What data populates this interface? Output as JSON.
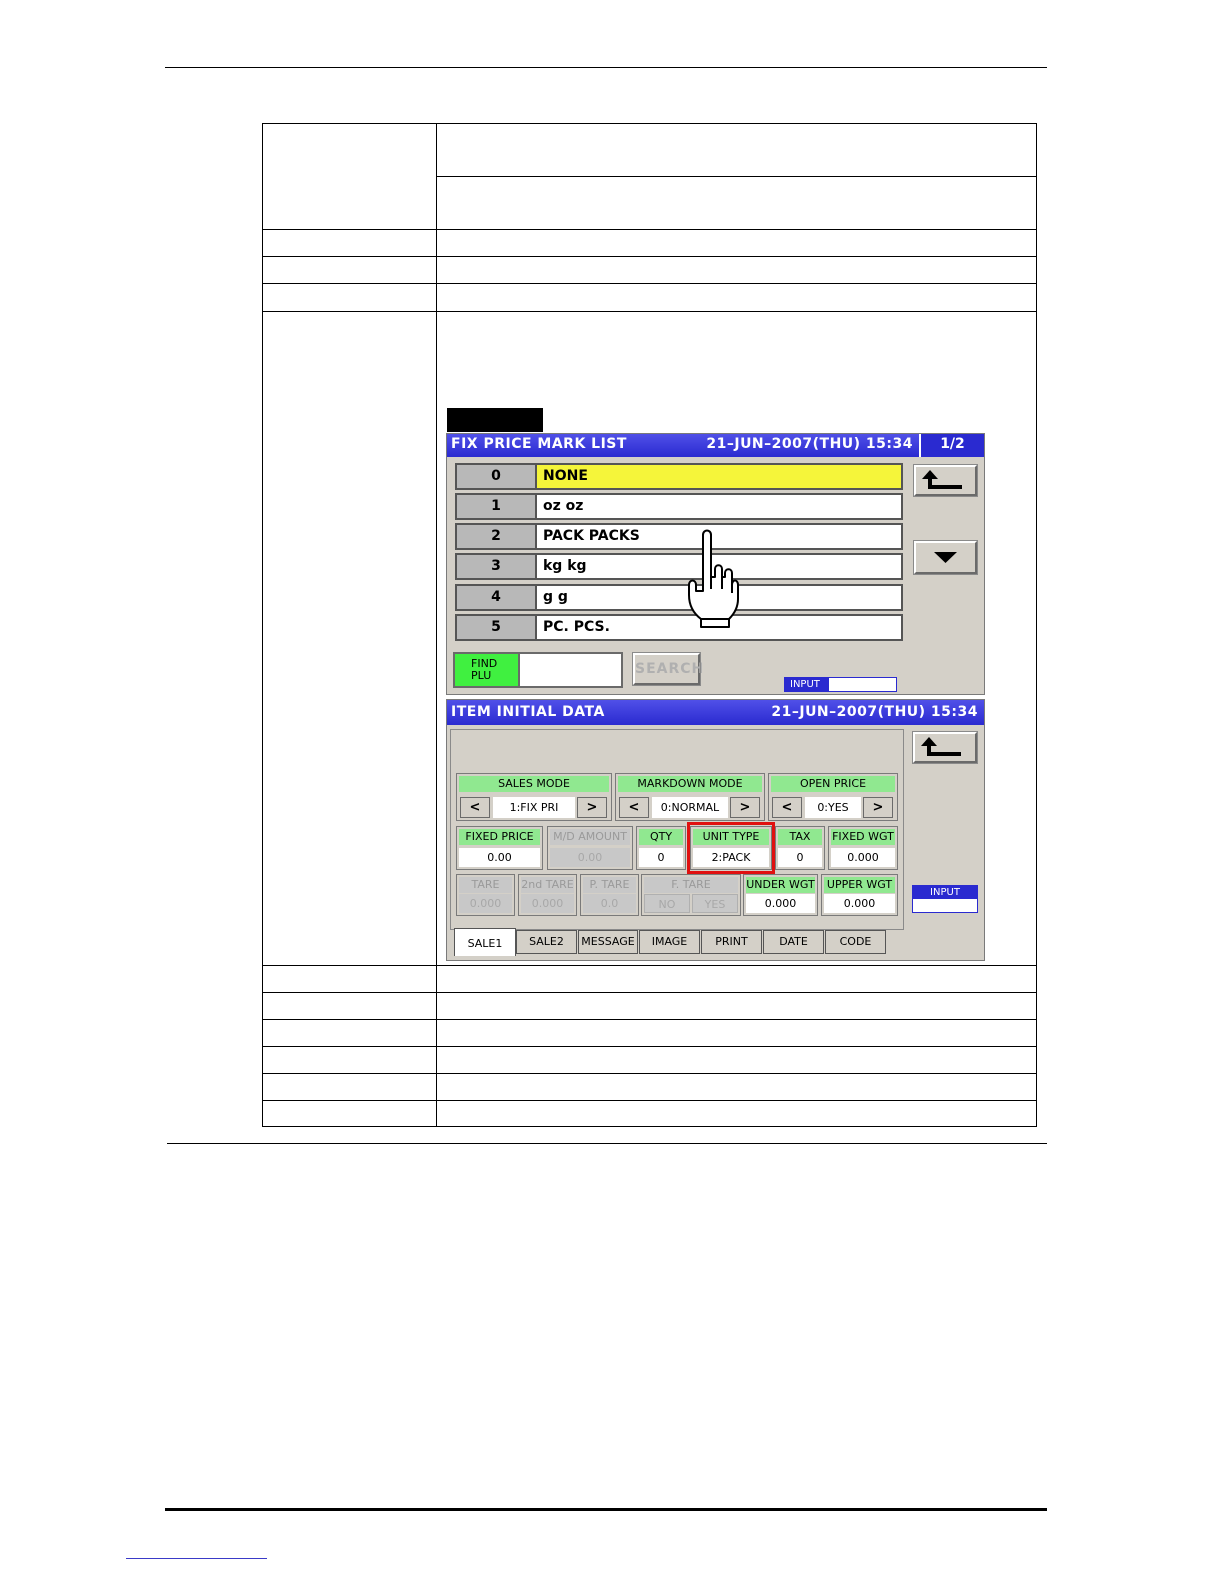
{
  "fix_price_mark_list": {
    "title": "FIX PRICE MARK LIST",
    "datetime": "21–JUN–2007(THU)  15:34",
    "page": "1/2",
    "items": [
      {
        "num": "0",
        "name": "NONE",
        "selected": true
      },
      {
        "num": "1",
        "name": "oz oz",
        "selected": false
      },
      {
        "num": "2",
        "name": "PACK PACKS",
        "selected": false
      },
      {
        "num": "3",
        "name": "kg kg",
        "selected": false
      },
      {
        "num": "4",
        "name": "g g",
        "selected": false
      },
      {
        "num": "5",
        "name": "PC. PCS.",
        "selected": false
      }
    ],
    "find_plu_label": "FIND\nPLU",
    "find_plu_line1": "FIND",
    "find_plu_line2": "PLU",
    "search_label": "SEARCH",
    "input_label": "INPUT"
  },
  "item_initial_data": {
    "title": "ITEM INITIAL DATA",
    "datetime": "21–JUN–2007(THU)  15:34",
    "sales_mode": {
      "label": "SALES MODE",
      "value": "1:FIX PRI"
    },
    "markdown_mode": {
      "label": "MARKDOWN MODE",
      "value": "0:NORMAL"
    },
    "open_price": {
      "label": "OPEN PRICE",
      "value": "0:YES"
    },
    "fixed_price": {
      "label": "FIXED PRICE",
      "value": "0.00"
    },
    "md_amount": {
      "label": "M/D AMOUNT",
      "value": "0.00"
    },
    "qty": {
      "label": "QTY",
      "value": "0"
    },
    "unit_type": {
      "label": "UNIT TYPE",
      "value": "2:PACK"
    },
    "tax": {
      "label": "TAX",
      "value": "0"
    },
    "fixed_wgt": {
      "label": "FIXED WGT",
      "value": "0.000"
    },
    "tare": {
      "label": "TARE",
      "value": "0.000"
    },
    "tare2": {
      "label": "2nd TARE",
      "value": "0.000"
    },
    "p_tare": {
      "label": "P. TARE",
      "value": "0.0"
    },
    "f_tare": {
      "label": "F. TARE",
      "no": "NO",
      "yes": "YES"
    },
    "under_wgt": {
      "label": "UNDER WGT",
      "value": "0.000"
    },
    "upper_wgt": {
      "label": "UPPER WGT",
      "value": "0.000"
    },
    "input_label": "INPUT",
    "tabs": [
      "SALE1",
      "SALE2",
      "MESSAGE",
      "IMAGE",
      "PRINT",
      "DATE",
      "CODE"
    ],
    "active_tab": "SALE1"
  },
  "icons": {
    "back": "return-arrow-icon",
    "down": "triangle-down-icon",
    "hand": "pointing-hand-icon",
    "left": "<",
    "right": ">"
  },
  "colors": {
    "title_bar": "#2a2ad0",
    "selected_row": "#f5f53a",
    "field_header": "#90e890",
    "find_plu": "#40f040",
    "highlight_box": "#e01010"
  }
}
